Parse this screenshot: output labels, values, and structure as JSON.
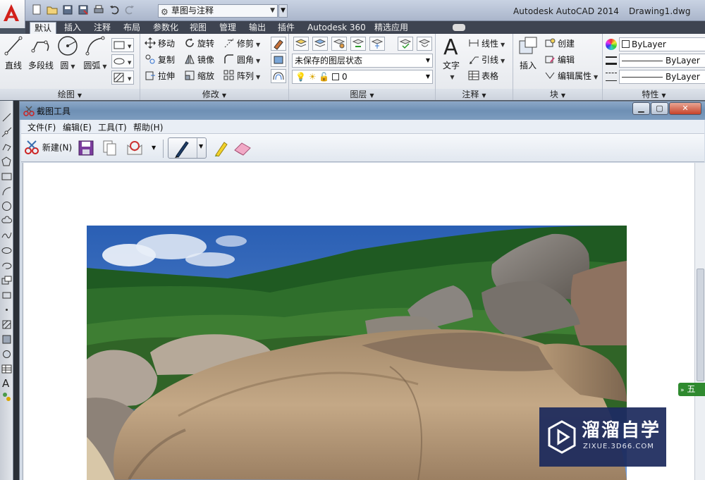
{
  "app": {
    "title": "Autodesk AutoCAD 2014",
    "document": "Drawing1.dwg",
    "workspace": "草图与注释"
  },
  "ribbon_tabs": [
    "默认",
    "插入",
    "注释",
    "布局",
    "参数化",
    "视图",
    "管理",
    "输出",
    "插件",
    "Autodesk 360",
    "精选应用"
  ],
  "panels": {
    "draw": {
      "title": "绘图",
      "line": "直线",
      "polyline": "多段线",
      "circle": "圆",
      "arc": "圆弧"
    },
    "modify": {
      "title": "修改",
      "move": "移动",
      "rotate": "旋转",
      "trim": "修剪",
      "copy": "复制",
      "mirror": "镜像",
      "fillet": "圆角",
      "stretch": "拉伸",
      "scale": "缩放",
      "array": "阵列"
    },
    "layers": {
      "title": "图层",
      "state": "未保存的图层状态",
      "current": "0"
    },
    "annotation": {
      "title": "注释",
      "text": "文字",
      "linear": "线性",
      "leader": "引线",
      "table": "表格"
    },
    "block": {
      "title": "块",
      "insert": "插入",
      "create": "创建",
      "edit": "编辑",
      "edit_attributes": "编辑属性"
    },
    "properties": {
      "title": "特性",
      "color": "ByLayer",
      "lineweight": "ByLayer",
      "linetype": "ByLayer"
    }
  },
  "snip": {
    "title": "截图工具",
    "menu": [
      "文件(F)",
      "编辑(E)",
      "工具(T)",
      "帮助(H)"
    ],
    "new_label": "新建(N)"
  },
  "ime": "五",
  "watermark": {
    "brand": "溜溜自学",
    "url": "ZIXUE.3D66.COM"
  }
}
